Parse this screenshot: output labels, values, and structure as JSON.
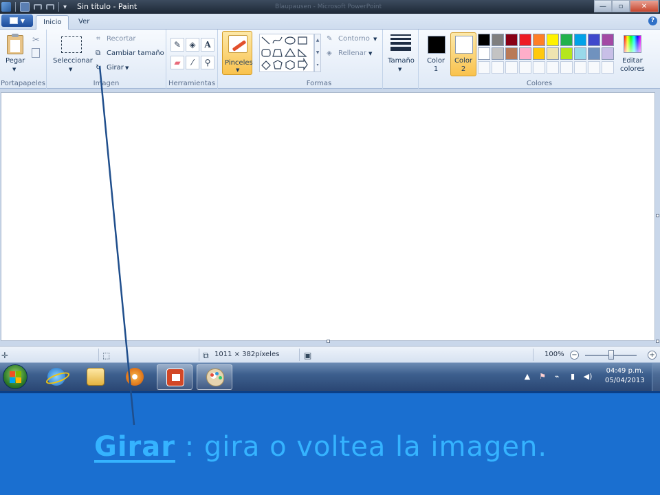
{
  "window": {
    "title": "Sin título - Paint",
    "background_title": "Blaupausen - Microsoft PowerPoint"
  },
  "tabs": [
    {
      "label": "Inicio",
      "active": true
    },
    {
      "label": "Ver",
      "active": false
    }
  ],
  "ribbon": {
    "clipboard": {
      "paste_label": "Pegar",
      "group_label": "Portapapeles"
    },
    "image": {
      "select_label": "Seleccionar",
      "crop_label": "Recortar",
      "resize_label": "Cambiar tamaño",
      "rotate_label": "Girar",
      "group_label": "Imagen"
    },
    "tools": {
      "group_label": "Herramientas"
    },
    "brushes": {
      "label": "Pinceles"
    },
    "shapes": {
      "outline_label": "Contorno",
      "fill_label": "Rellenar",
      "group_label": "Formas"
    },
    "size": {
      "label": "Tamaño"
    },
    "colors": {
      "color1_label_a": "Color",
      "color1_label_b": "1",
      "color2_label_a": "Color",
      "color2_label_b": "2",
      "color1_value": "#000000",
      "color2_value": "#ffffff",
      "edit_label_a": "Editar",
      "edit_label_b": "colores",
      "group_label": "Colores",
      "palette_row1": [
        "#000000",
        "#7f7f7f",
        "#880015",
        "#ed1c24",
        "#ff7f27",
        "#fff200",
        "#22b14c",
        "#00a2e8",
        "#3f48cc",
        "#a349a4"
      ],
      "palette_row2": [
        "#ffffff",
        "#c3c3c3",
        "#b97a57",
        "#ffaec9",
        "#ffc90e",
        "#efe4b0",
        "#b5e61d",
        "#99d9ea",
        "#7092be",
        "#c8bfe7"
      ]
    }
  },
  "statusbar": {
    "dimensions": "1011 × 382píxeles",
    "zoom": "100%",
    "zoom_level": 0.5
  },
  "tray": {
    "time": "04:49 p.m.",
    "date": "05/04/2013"
  },
  "caption": {
    "term": "Girar",
    "separator": " : ",
    "description": "gira o voltea la imagen."
  },
  "accent_colors": {
    "caption_background": "#1a6fd0",
    "caption_text": "#35b3ff",
    "pointer_line": "#1f4e8c"
  }
}
